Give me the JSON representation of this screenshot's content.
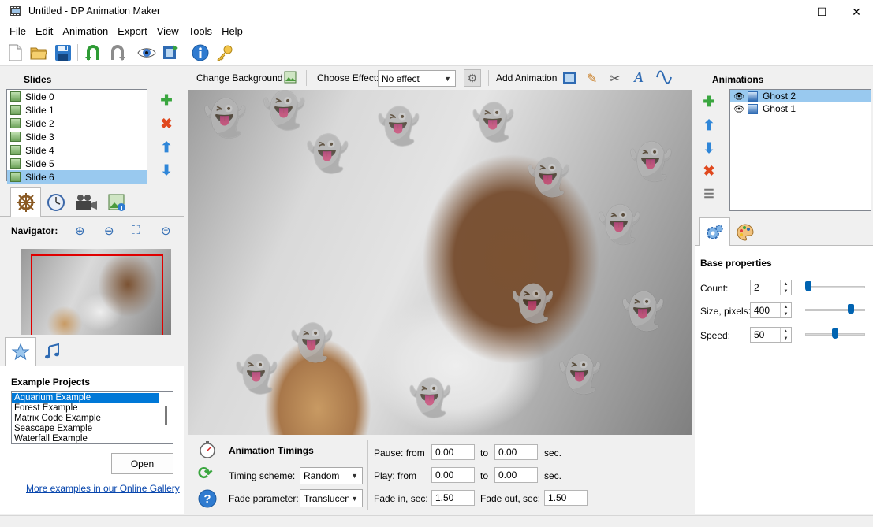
{
  "window": {
    "title": "Untitled - DP Animation Maker",
    "minimize_glyph": "—",
    "maximize_glyph": "☐",
    "close_glyph": "✕"
  },
  "menu": [
    "File",
    "Edit",
    "Animation",
    "Export",
    "View",
    "Tools",
    "Help"
  ],
  "toolbar_icons": [
    "new-file-icon",
    "open-folder-icon",
    "save-icon",
    "undo-icon",
    "redo-icon",
    "preview-eye-icon",
    "export-film-icon",
    "info-icon",
    "key-icon"
  ],
  "slides": {
    "title": "Slides",
    "items": [
      "Slide 0",
      "Slide 1",
      "Slide 2",
      "Slide 3",
      "Slide 4",
      "Slide 5",
      "Slide 6"
    ],
    "selected": "Slide 6"
  },
  "navigator": {
    "label": "Navigator:"
  },
  "examples": {
    "title": "Example Projects",
    "items": [
      "Aquarium Example",
      "Forest Example",
      "Matrix Code Example",
      "Seascape Example",
      "Waterfall Example"
    ],
    "selected": "Aquarium Example",
    "open_label": "Open",
    "gallery_link": "More examples in our Online Gallery"
  },
  "canvas_toolbar": {
    "change_background": "Change Background",
    "choose_effect_label": "Choose Effect:",
    "effect_value": "No effect",
    "add_animation": "Add Animation"
  },
  "timings": {
    "title": "Animation Timings",
    "scheme_label": "Timing scheme:",
    "scheme_value": "Random",
    "fade_label": "Fade parameter:",
    "fade_value": "Translucenc",
    "pause_from_label": "Pause: from",
    "pause_from": "0.00",
    "pause_to_label": "to",
    "pause_to": "0.00",
    "play_from_label": "Play: from",
    "play_from": "0.00",
    "play_to_label": "to",
    "play_to": "0.00",
    "sec_label": "sec.",
    "fade_in_label": "Fade in, sec:",
    "fade_in": "1.50",
    "fade_out_label": "Fade out, sec:",
    "fade_out": "1.50"
  },
  "animations": {
    "title": "Animations",
    "items": [
      "Ghost 2",
      "Ghost 1"
    ],
    "selected": "Ghost 2"
  },
  "base_properties": {
    "title": "Base properties",
    "count_label": "Count:",
    "count": "2",
    "count_level": 0.0,
    "size_label": "Size, pixels:",
    "size": "400",
    "size_level": 0.8,
    "speed_label": "Speed:",
    "speed": "50",
    "speed_level": 0.5
  },
  "colors": {
    "selection": "#99c9ef",
    "list_selection": "#0078d7",
    "nav_frame": "#e00000",
    "slider_thumb": "#0063b1"
  }
}
